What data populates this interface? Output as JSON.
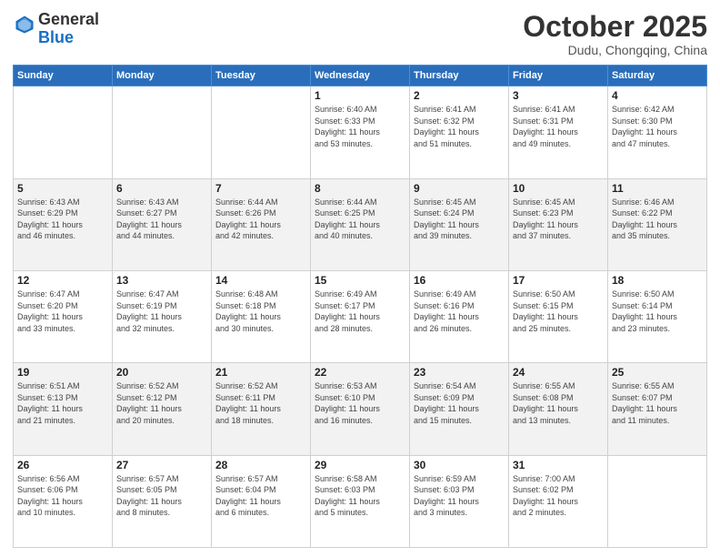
{
  "logo": {
    "general": "General",
    "blue": "Blue"
  },
  "header": {
    "month": "October 2025",
    "location": "Dudu, Chongqing, China"
  },
  "days_of_week": [
    "Sunday",
    "Monday",
    "Tuesday",
    "Wednesday",
    "Thursday",
    "Friday",
    "Saturday"
  ],
  "weeks": [
    {
      "shaded": false,
      "days": [
        {
          "num": "",
          "detail": ""
        },
        {
          "num": "",
          "detail": ""
        },
        {
          "num": "",
          "detail": ""
        },
        {
          "num": "1",
          "detail": "Sunrise: 6:40 AM\nSunset: 6:33 PM\nDaylight: 11 hours\nand 53 minutes."
        },
        {
          "num": "2",
          "detail": "Sunrise: 6:41 AM\nSunset: 6:32 PM\nDaylight: 11 hours\nand 51 minutes."
        },
        {
          "num": "3",
          "detail": "Sunrise: 6:41 AM\nSunset: 6:31 PM\nDaylight: 11 hours\nand 49 minutes."
        },
        {
          "num": "4",
          "detail": "Sunrise: 6:42 AM\nSunset: 6:30 PM\nDaylight: 11 hours\nand 47 minutes."
        }
      ]
    },
    {
      "shaded": true,
      "days": [
        {
          "num": "5",
          "detail": "Sunrise: 6:43 AM\nSunset: 6:29 PM\nDaylight: 11 hours\nand 46 minutes."
        },
        {
          "num": "6",
          "detail": "Sunrise: 6:43 AM\nSunset: 6:27 PM\nDaylight: 11 hours\nand 44 minutes."
        },
        {
          "num": "7",
          "detail": "Sunrise: 6:44 AM\nSunset: 6:26 PM\nDaylight: 11 hours\nand 42 minutes."
        },
        {
          "num": "8",
          "detail": "Sunrise: 6:44 AM\nSunset: 6:25 PM\nDaylight: 11 hours\nand 40 minutes."
        },
        {
          "num": "9",
          "detail": "Sunrise: 6:45 AM\nSunset: 6:24 PM\nDaylight: 11 hours\nand 39 minutes."
        },
        {
          "num": "10",
          "detail": "Sunrise: 6:45 AM\nSunset: 6:23 PM\nDaylight: 11 hours\nand 37 minutes."
        },
        {
          "num": "11",
          "detail": "Sunrise: 6:46 AM\nSunset: 6:22 PM\nDaylight: 11 hours\nand 35 minutes."
        }
      ]
    },
    {
      "shaded": false,
      "days": [
        {
          "num": "12",
          "detail": "Sunrise: 6:47 AM\nSunset: 6:20 PM\nDaylight: 11 hours\nand 33 minutes."
        },
        {
          "num": "13",
          "detail": "Sunrise: 6:47 AM\nSunset: 6:19 PM\nDaylight: 11 hours\nand 32 minutes."
        },
        {
          "num": "14",
          "detail": "Sunrise: 6:48 AM\nSunset: 6:18 PM\nDaylight: 11 hours\nand 30 minutes."
        },
        {
          "num": "15",
          "detail": "Sunrise: 6:49 AM\nSunset: 6:17 PM\nDaylight: 11 hours\nand 28 minutes."
        },
        {
          "num": "16",
          "detail": "Sunrise: 6:49 AM\nSunset: 6:16 PM\nDaylight: 11 hours\nand 26 minutes."
        },
        {
          "num": "17",
          "detail": "Sunrise: 6:50 AM\nSunset: 6:15 PM\nDaylight: 11 hours\nand 25 minutes."
        },
        {
          "num": "18",
          "detail": "Sunrise: 6:50 AM\nSunset: 6:14 PM\nDaylight: 11 hours\nand 23 minutes."
        }
      ]
    },
    {
      "shaded": true,
      "days": [
        {
          "num": "19",
          "detail": "Sunrise: 6:51 AM\nSunset: 6:13 PM\nDaylight: 11 hours\nand 21 minutes."
        },
        {
          "num": "20",
          "detail": "Sunrise: 6:52 AM\nSunset: 6:12 PM\nDaylight: 11 hours\nand 20 minutes."
        },
        {
          "num": "21",
          "detail": "Sunrise: 6:52 AM\nSunset: 6:11 PM\nDaylight: 11 hours\nand 18 minutes."
        },
        {
          "num": "22",
          "detail": "Sunrise: 6:53 AM\nSunset: 6:10 PM\nDaylight: 11 hours\nand 16 minutes."
        },
        {
          "num": "23",
          "detail": "Sunrise: 6:54 AM\nSunset: 6:09 PM\nDaylight: 11 hours\nand 15 minutes."
        },
        {
          "num": "24",
          "detail": "Sunrise: 6:55 AM\nSunset: 6:08 PM\nDaylight: 11 hours\nand 13 minutes."
        },
        {
          "num": "25",
          "detail": "Sunrise: 6:55 AM\nSunset: 6:07 PM\nDaylight: 11 hours\nand 11 minutes."
        }
      ]
    },
    {
      "shaded": false,
      "days": [
        {
          "num": "26",
          "detail": "Sunrise: 6:56 AM\nSunset: 6:06 PM\nDaylight: 11 hours\nand 10 minutes."
        },
        {
          "num": "27",
          "detail": "Sunrise: 6:57 AM\nSunset: 6:05 PM\nDaylight: 11 hours\nand 8 minutes."
        },
        {
          "num": "28",
          "detail": "Sunrise: 6:57 AM\nSunset: 6:04 PM\nDaylight: 11 hours\nand 6 minutes."
        },
        {
          "num": "29",
          "detail": "Sunrise: 6:58 AM\nSunset: 6:03 PM\nDaylight: 11 hours\nand 5 minutes."
        },
        {
          "num": "30",
          "detail": "Sunrise: 6:59 AM\nSunset: 6:03 PM\nDaylight: 11 hours\nand 3 minutes."
        },
        {
          "num": "31",
          "detail": "Sunrise: 7:00 AM\nSunset: 6:02 PM\nDaylight: 11 hours\nand 2 minutes."
        },
        {
          "num": "",
          "detail": ""
        }
      ]
    }
  ]
}
